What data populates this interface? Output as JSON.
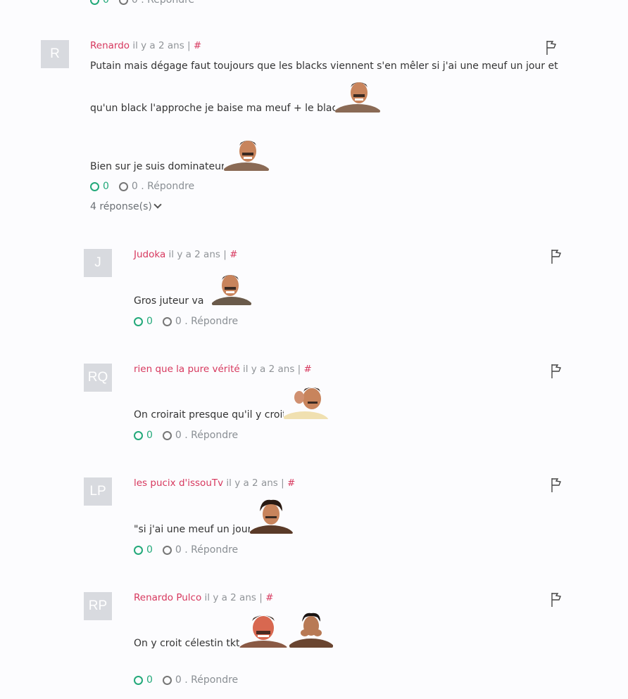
{
  "top_votes": {
    "up": "0",
    "down": "0 . Répondre"
  },
  "comments": [
    {
      "initials": "R",
      "author": "Renardo",
      "time": "il y a 2 ans |",
      "hash": "#",
      "lines": [
        "Putain mais dégage faut toujours que les blacks viennent s'en mêler si j'ai une meuf un jour et",
        "qu'un black l'approche je baise ma meuf + le black",
        "Bien sur je suis dominateur"
      ],
      "up": "0",
      "down": "0 . Répondre",
      "replies_toggle": "4 réponse(s)"
    },
    {
      "initials": "J",
      "author": "Judoka",
      "time": "il y a 2 ans |",
      "hash": "#",
      "text": "Gros juteur va",
      "up": "0",
      "down": "0 . Répondre"
    },
    {
      "initials": "RQ",
      "author": "rien que la pure vérité",
      "time": "il y a 2 ans |",
      "hash": "#",
      "text": "On croirait presque qu'il y croit",
      "up": "0",
      "down": "0 . Répondre"
    },
    {
      "initials": "LP",
      "author": "les pucix d'issouTv",
      "time": "il y a 2 ans |",
      "hash": "#",
      "text": "\"si j'ai une meuf un jour\"",
      "up": "0",
      "down": "0 . Répondre"
    },
    {
      "initials": "RP",
      "author": "Renardo Pulco",
      "time": "il y a 2 ans |",
      "hash": "#",
      "text": "On y croit célestin tkt",
      "up": "0",
      "down": "0 . Répondre"
    }
  ],
  "colors": {
    "author": "#d7385e",
    "upvote": "#23a97a",
    "meta": "#909498",
    "avatar_bg": "#d8dadf"
  },
  "icons": [
    "flag-icon",
    "upvote-circle-icon",
    "downvote-circle-icon",
    "chevron-down-icon",
    "risitas-sticker"
  ]
}
